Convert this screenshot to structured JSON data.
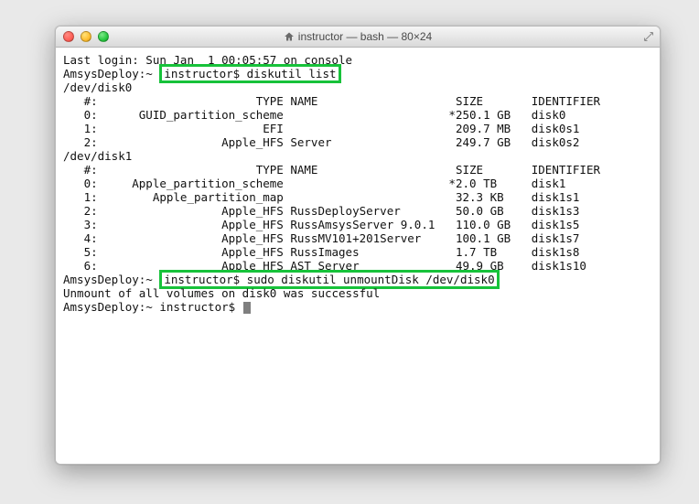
{
  "window": {
    "title": "instructor — bash — 80×24"
  },
  "term": {
    "login_line": "Last login: Sun Jan  1 00:05:57 on console",
    "prompt_host": "AmsysDeploy:~ ",
    "prompt_user_and_cmd1": "instructor$ diskutil list",
    "disk0_header": "/dev/disk0",
    "col_header": "   #:                       TYPE NAME                    SIZE       IDENTIFIER",
    "d0_r0": "   0:      GUID_partition_scheme                        *250.1 GB   disk0",
    "d0_r1": "   1:                        EFI                         209.7 MB   disk0s1",
    "d0_r2": "   2:                  Apple_HFS Server                  249.7 GB   disk0s2",
    "disk1_header": "/dev/disk1",
    "d1_r0": "   0:     Apple_partition_scheme                        *2.0 TB     disk1",
    "d1_r1": "   1:        Apple_partition_map                         32.3 KB    disk1s1",
    "d1_r2": "   2:                  Apple_HFS RussDeployServer        50.0 GB    disk1s3",
    "d1_r3": "   3:                  Apple_HFS RussAmsysServer 9.0.1   110.0 GB   disk1s5",
    "d1_r4": "   4:                  Apple_HFS RussMV101+201Server     100.1 GB   disk1s7",
    "d1_r5": "   5:                  Apple_HFS RussImages              1.7 TB     disk1s8",
    "d1_r6": "   6:                  Apple_HFS AST Server              49.9 GB    disk1s10",
    "prompt_user_and_cmd2": "instructor$ sudo diskutil unmountDisk /dev/disk0",
    "unmount_result": "Unmount of all volumes on disk0 was successful",
    "prompt_final": "AmsysDeploy:~ instructor$ "
  },
  "highlights": [
    "instructor$ diskutil list",
    "instructor$ sudo diskutil unmountDisk /dev/disk0"
  ]
}
